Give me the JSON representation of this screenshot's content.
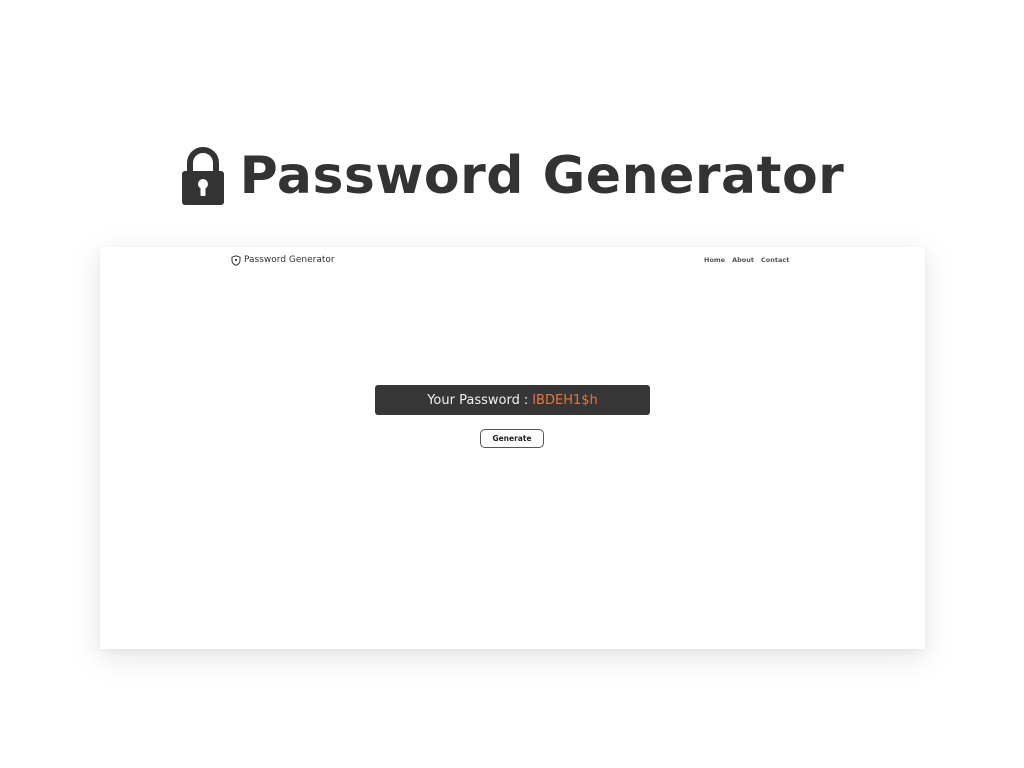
{
  "hero": {
    "icon": "lock-icon",
    "title": "Password Generator"
  },
  "navbar": {
    "brand_icon": "shield-icon",
    "brand": "Password Generator",
    "links": [
      "Home",
      "About",
      "Contact"
    ]
  },
  "main": {
    "password_label": "Your Password",
    "separator": ":",
    "password_value": "IBDEH1$h",
    "generate_label": "Generate"
  },
  "colors": {
    "title_text": "#333333",
    "password_box_bg": "#363636",
    "password_value": "#e8743b",
    "page_bg": "#ffffff"
  }
}
